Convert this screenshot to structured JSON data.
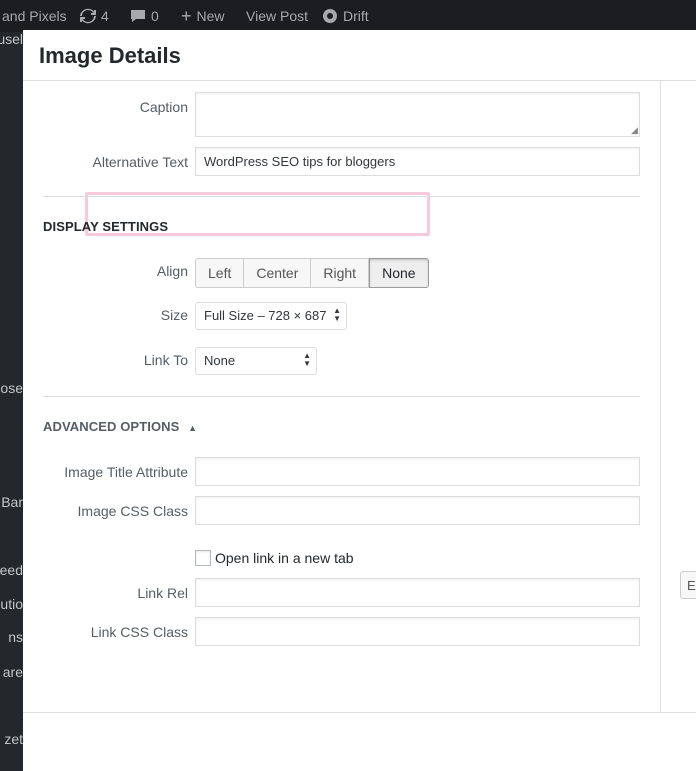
{
  "adminbar": {
    "site_fragment": "and Pixels",
    "updates_count": "4",
    "comments_count": "0",
    "new_label": "New",
    "view_post_label": "View Post",
    "drift_label": "Drift"
  },
  "sidemenu": {
    "items": [
      "usel",
      "ose",
      "Bar",
      "eed",
      "utio",
      "ns",
      "are",
      "zet"
    ]
  },
  "modal": {
    "title": "Image Details",
    "caption_label": "Caption",
    "caption_value": "",
    "alt_label": "Alternative Text",
    "alt_value": "WordPress SEO tips for bloggers",
    "display_settings_heading": "DISPLAY SETTINGS",
    "align_label": "Align",
    "align_options": [
      "Left",
      "Center",
      "Right",
      "None"
    ],
    "align_selected": "None",
    "size_label": "Size",
    "size_value": "Full Size – 728 × 687",
    "link_to_label": "Link To",
    "link_to_value": "None",
    "advanced_heading": "ADVANCED OPTIONS",
    "title_attr_label": "Image Title Attribute",
    "css_class_label": "Image CSS Class",
    "open_new_tab_label": "Open link in a new tab",
    "link_rel_label": "Link Rel",
    "link_css_label": "Link CSS Class",
    "edge_button_label": "E"
  },
  "colors": {
    "highlight": "#f8c8dc",
    "admin_bg": "#23282d"
  }
}
